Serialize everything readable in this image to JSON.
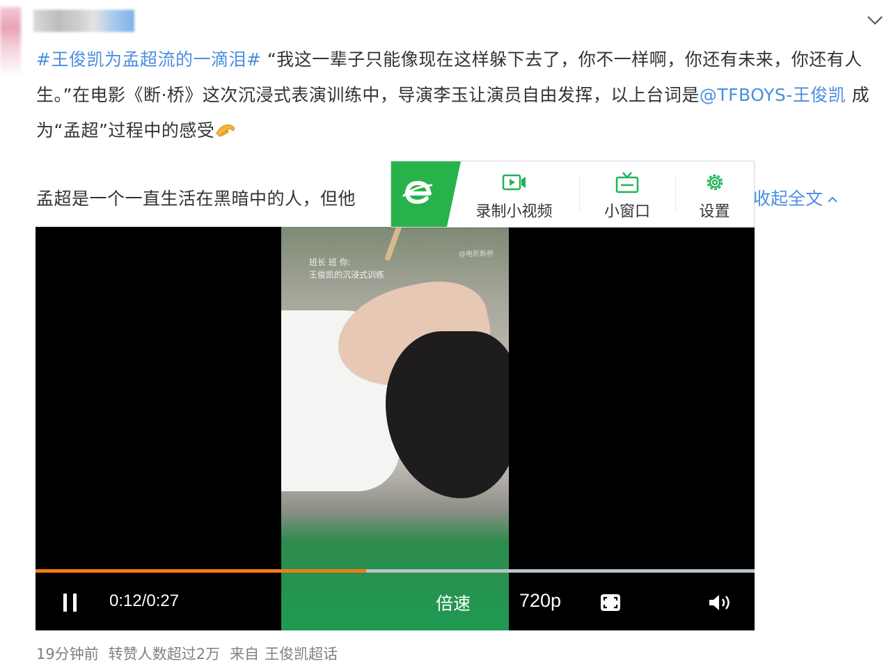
{
  "post": {
    "hashtag": "#王俊凯为孟超流的一滴泪#",
    "text_1": " “我这一辈子只能像现在这样躲下去了，你不一样啊，你还有未来，你还有人生。”在电影《断·桥》这次沉浸式表演训练中，导演李玉让演员自由发挥，以上台词是",
    "mention": "@TFBOYS-王俊凯",
    "text_2": " 成为“孟超”过程中的感受",
    "emoji": "hands-emoji",
    "second_paragraph": "孟超是一个一直生活在黑暗中的人，但他",
    "collapse_label": "收起全文"
  },
  "toolbar": {
    "logo": "e-browser-logo",
    "record_label": "录制小视频",
    "mini_window_label": "小窗口",
    "settings_label": "设置"
  },
  "video": {
    "frame_caption_line1": "班长 班 你:",
    "frame_caption_line2": "王俊凯的沉浸式训练",
    "frame_watermark": "@电影断桥",
    "time": "0:12/0:27",
    "progress": 0.46,
    "speed_label": "倍速",
    "quality_label": "720p"
  },
  "footer": {
    "time_ago": "19分钟前",
    "repost_info": "转赞人数超过2万",
    "source_label": "来自",
    "source_name": "王俊凯超话"
  },
  "colors": {
    "link": "#4a8ee0",
    "progress": "#f07d17",
    "brand_green": "#27b34a"
  }
}
